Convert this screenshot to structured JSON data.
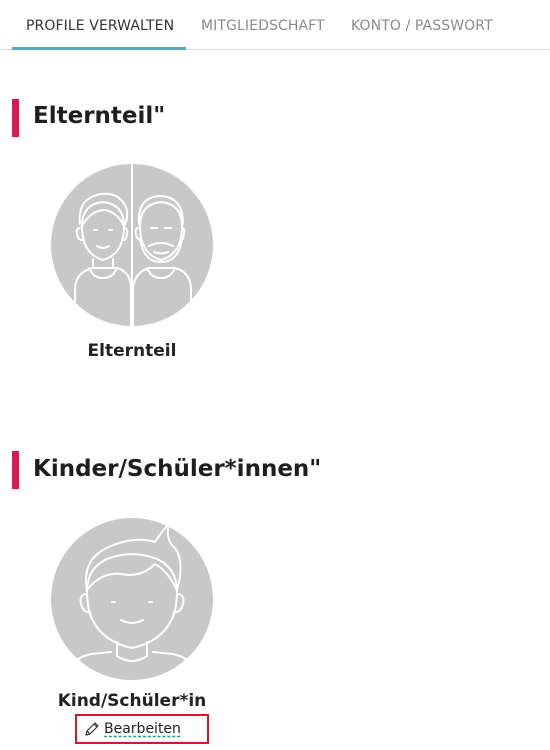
{
  "tabs": [
    {
      "label": "PROFILE VERWALTEN",
      "active": true
    },
    {
      "label": "MITGLIEDSCHAFT",
      "active": false
    },
    {
      "label": "KONTO / PASSWORT",
      "active": false
    }
  ],
  "sections": {
    "parent": {
      "title": "Elternteil\"",
      "profile_label": "Elternteil"
    },
    "children": {
      "title": "Kinder/Schüler*innen\"",
      "profile_label": "Kind/Schüler*in",
      "edit_label": "Bearbeiten"
    }
  },
  "colors": {
    "accent_bar": "#d8194d",
    "tab_underline": "#5aa6bd",
    "avatar_bg": "#c8c8c8",
    "highlight_box": "#d11a2a"
  },
  "icons": {
    "edit": "pencil-icon"
  }
}
